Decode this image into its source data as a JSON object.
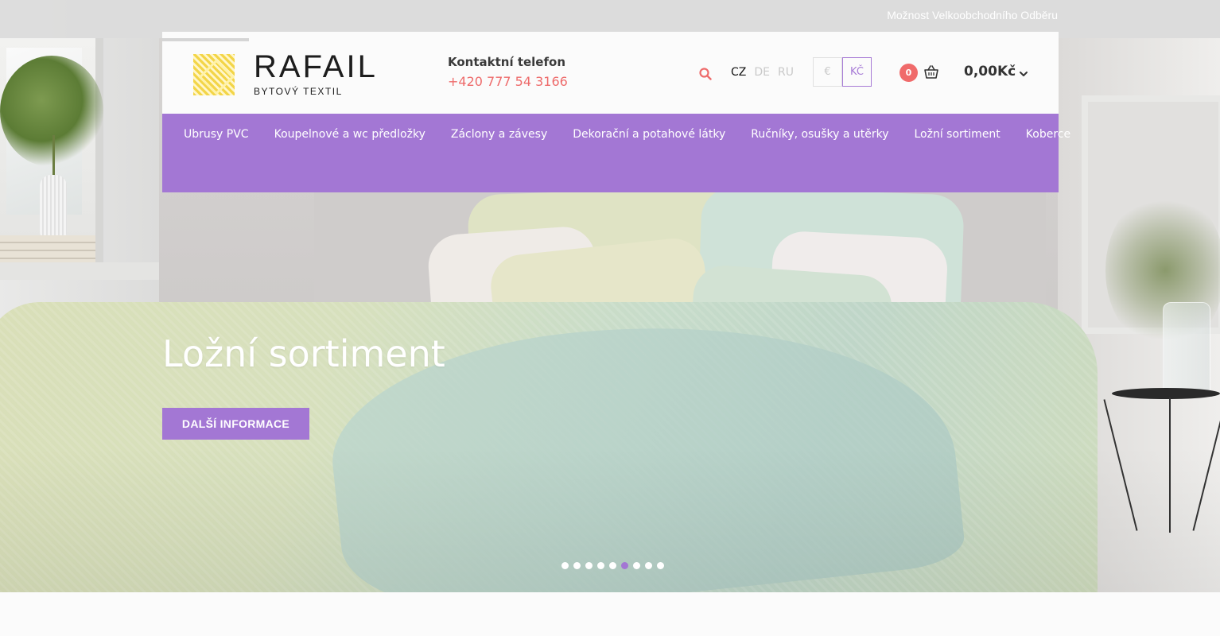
{
  "topbar": {
    "wholesale_link": "Možnost Velkoobchodního Odběru"
  },
  "header": {
    "logo": {
      "name": "RAFAIL",
      "tagline": "BYTOVÝ TEXTIL"
    },
    "contact": {
      "label": "Kontaktní telefon",
      "phone": "+420 777 54 3166"
    },
    "languages": [
      {
        "code": "CZ",
        "active": true
      },
      {
        "code": "DE",
        "active": false
      },
      {
        "code": "RU",
        "active": false
      }
    ],
    "currencies": [
      {
        "symbol": "€",
        "active": false
      },
      {
        "symbol": "KČ",
        "active": true
      }
    ],
    "cart": {
      "count": "0",
      "total": "0,00Kč"
    },
    "icons": {
      "search": "search-icon",
      "cart": "basket-icon",
      "chevron": "chevron-down-icon"
    }
  },
  "nav": {
    "items": [
      "Ubrusy PVC",
      "Koupelnové a wc předložky",
      "Záclony a závesy",
      "Dekorační a potahové látky",
      "Ručníky, osušky a utěrky",
      "Ložní sortiment",
      "Koberce"
    ]
  },
  "hero": {
    "title": "Ložní sortiment",
    "button_label": "DALŠÍ INFORMACE",
    "slide_count": 9,
    "active_slide": 6
  },
  "colors": {
    "accent": "#a377d4",
    "phone": "#ee6b6b",
    "badge": "#f06b6b",
    "logo_yellow": "#f3d548"
  }
}
